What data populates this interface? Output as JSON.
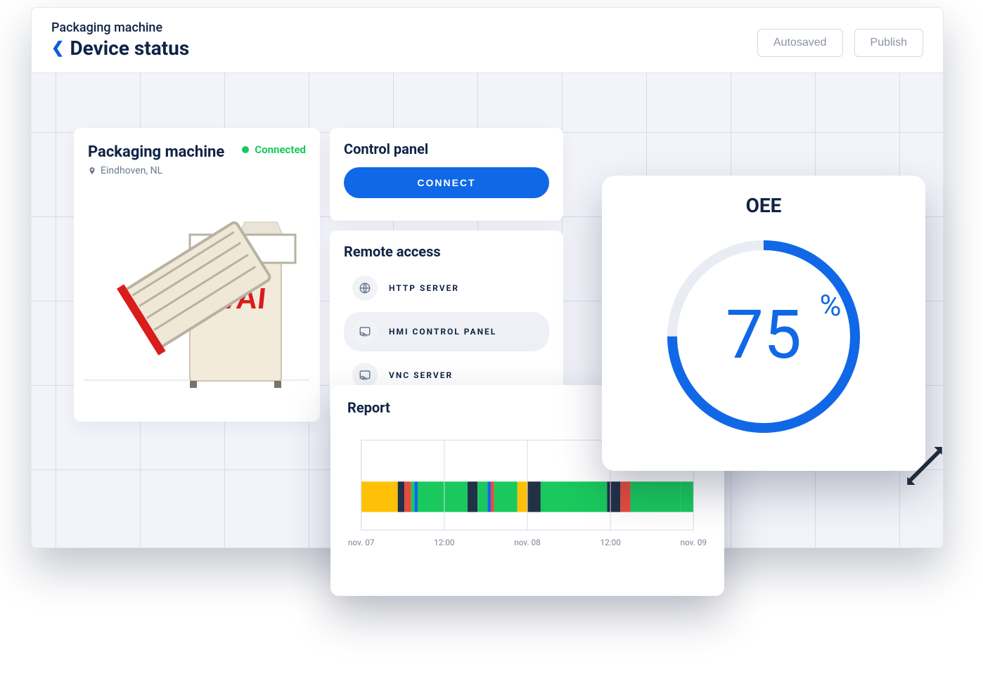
{
  "breadcrumb": "Packaging machine",
  "page_title": "Device status",
  "actions": {
    "autosaved": "Autosaved",
    "publish": "Publish"
  },
  "device": {
    "title": "Packaging machine",
    "status_label": "Connected",
    "location": "Eindhoven, NL"
  },
  "control_panel": {
    "title": "Control panel",
    "connect_label": "CONNECT"
  },
  "remote_access": {
    "title": "Remote access",
    "items": [
      {
        "label": "HTTP SERVER",
        "icon": "globe-icon",
        "selected": false
      },
      {
        "label": "HMI CONTROL PANEL",
        "icon": "cast-icon",
        "selected": true
      },
      {
        "label": "VNC SERVER",
        "icon": "cast-icon",
        "selected": false
      }
    ]
  },
  "oee": {
    "title": "OEE",
    "value_text": "75",
    "unit": "%",
    "value": 75
  },
  "report": {
    "title": "Report"
  },
  "chart_data": [
    {
      "type": "area",
      "title": "OEE",
      "values": [
        75
      ],
      "unit": "%",
      "ylim": [
        0,
        100
      ]
    },
    {
      "type": "bar",
      "title": "Report",
      "xlabel": "",
      "ylabel": "",
      "x_range": [
        "nov. 07",
        "nov. 09"
      ],
      "ticks": [
        "nov. 07",
        "12:00",
        "nov. 08",
        "12:00",
        "nov. 09"
      ],
      "segments": [
        {
          "start": 0.0,
          "end": 0.11,
          "state": "idle",
          "color": "#ffc107"
        },
        {
          "start": 0.11,
          "end": 0.13,
          "state": "fault",
          "color": "#233147"
        },
        {
          "start": 0.13,
          "end": 0.15,
          "state": "alarm",
          "color": "#e74c3c"
        },
        {
          "start": 0.15,
          "end": 0.16,
          "state": "run",
          "color": "#19c95e"
        },
        {
          "start": 0.16,
          "end": 0.17,
          "state": "info",
          "color": "#1068e6"
        },
        {
          "start": 0.17,
          "end": 0.32,
          "state": "run",
          "color": "#19c95e"
        },
        {
          "start": 0.32,
          "end": 0.35,
          "state": "fault",
          "color": "#233147"
        },
        {
          "start": 0.35,
          "end": 0.38,
          "state": "run",
          "color": "#19c95e"
        },
        {
          "start": 0.38,
          "end": 0.39,
          "state": "info",
          "color": "#1068e6"
        },
        {
          "start": 0.39,
          "end": 0.4,
          "state": "alarm",
          "color": "#e74c3c"
        },
        {
          "start": 0.4,
          "end": 0.47,
          "state": "run",
          "color": "#19c95e"
        },
        {
          "start": 0.47,
          "end": 0.5,
          "state": "idle",
          "color": "#ffc107"
        },
        {
          "start": 0.5,
          "end": 0.54,
          "state": "fault",
          "color": "#233147"
        },
        {
          "start": 0.54,
          "end": 0.74,
          "state": "run",
          "color": "#19c95e"
        },
        {
          "start": 0.74,
          "end": 0.78,
          "state": "fault",
          "color": "#233147"
        },
        {
          "start": 0.78,
          "end": 0.81,
          "state": "alarm",
          "color": "#e74c3c"
        },
        {
          "start": 0.81,
          "end": 0.96,
          "state": "run",
          "color": "#19c95e"
        },
        {
          "start": 0.96,
          "end": 1.0,
          "state": "run",
          "color": "#19c95e"
        }
      ]
    }
  ]
}
